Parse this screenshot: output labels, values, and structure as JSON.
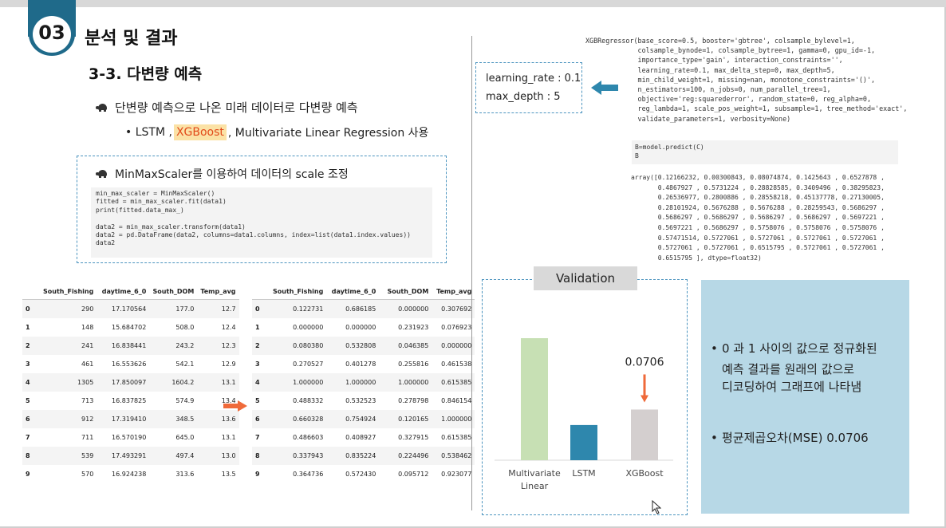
{
  "slide": {
    "section_number": "03",
    "section_title": "분석 및 결과",
    "subtitle": "3-3. 다변량 예측"
  },
  "bullets": {
    "main": "단변량 예측으로 나온 미래 데이터로 다변량 예측",
    "sub_prefix": "• LSTM ,",
    "sub_highlight": "XGBoost",
    "sub_suffix": ", Multivariate Linear Regression 사용"
  },
  "scaler_box": {
    "heading": "MinMaxScaler를 이용하여 데이터의 scale 조정",
    "code": "min_max_scaler = MinMaxScaler()\nfitted = min_max_scaler.fit(data1)\nprint(fitted.data_max_)\n\ndata2 = min_max_scaler.transform(data1)\ndata2 = pd.DataFrame(data2, columns=data1.columns, index=list(data1.index.values))\ndata2"
  },
  "table_raw": {
    "columns": [
      "",
      "South_Fishing",
      "daytime_6_0",
      "South_DOM",
      "Temp_avg"
    ],
    "rows": [
      [
        "0",
        "290",
        "17.170564",
        "177.0",
        "12.7"
      ],
      [
        "1",
        "148",
        "15.684702",
        "508.0",
        "12.4"
      ],
      [
        "2",
        "241",
        "16.838441",
        "243.2",
        "12.3"
      ],
      [
        "3",
        "461",
        "16.553626",
        "542.1",
        "12.9"
      ],
      [
        "4",
        "1305",
        "17.850097",
        "1604.2",
        "13.1"
      ],
      [
        "5",
        "713",
        "16.837825",
        "574.9",
        "13.4"
      ],
      [
        "6",
        "912",
        "17.319410",
        "348.5",
        "13.6"
      ],
      [
        "7",
        "711",
        "16.570190",
        "645.0",
        "13.1"
      ],
      [
        "8",
        "539",
        "17.493291",
        "497.4",
        "13.0"
      ],
      [
        "9",
        "570",
        "16.924238",
        "313.6",
        "13.5"
      ]
    ]
  },
  "table_scaled": {
    "columns": [
      "",
      "South_Fishing",
      "daytime_6_0",
      "South_DOM",
      "Temp_avg"
    ],
    "rows": [
      [
        "0",
        "0.122731",
        "0.686185",
        "0.000000",
        "0.307692"
      ],
      [
        "1",
        "0.000000",
        "0.000000",
        "0.231923",
        "0.076923"
      ],
      [
        "2",
        "0.080380",
        "0.532808",
        "0.046385",
        "0.000000"
      ],
      [
        "3",
        "0.270527",
        "0.401278",
        "0.255816",
        "0.461538"
      ],
      [
        "4",
        "1.000000",
        "1.000000",
        "1.000000",
        "0.615385"
      ],
      [
        "5",
        "0.488332",
        "0.532523",
        "0.278798",
        "0.846154"
      ],
      [
        "6",
        "0.660328",
        "0.754924",
        "0.120165",
        "1.000000"
      ],
      [
        "7",
        "0.486603",
        "0.408927",
        "0.327915",
        "0.615385"
      ],
      [
        "8",
        "0.337943",
        "0.835224",
        "0.224496",
        "0.538462"
      ],
      [
        "9",
        "0.364736",
        "0.572430",
        "0.095712",
        "0.923077"
      ]
    ]
  },
  "params": {
    "learning_rate": "learning_rate : 0.1",
    "max_depth": "max_depth : 5"
  },
  "xgb_repr": "XGBRegressor(base_score=0.5, booster='gbtree', colsample_bylevel=1,\n             colsample_bynode=1, colsample_bytree=1, gamma=0, gpu_id=-1,\n             importance_type='gain', interaction_constraints='',\n             learning_rate=0.1, max_delta_step=0, max_depth=5,\n             min_child_weight=1, missing=nan, monotone_constraints='()',\n             n_estimators=100, n_jobs=0, num_parallel_tree=1,\n             objective='reg:squarederror', random_state=0, reg_alpha=0,\n             reg_lambda=1, scale_pos_weight=1, subsample=1, tree_method='exact',\n             validate_parameters=1, verbosity=None)",
  "predict_code": "B=model.predict(C)\nB",
  "array_output": "array([0.12166232, 0.00300843, 0.08074874, 0.1425643 , 0.6527878 ,\n       0.4867927 , 0.5731224 , 0.28828585, 0.3409496 , 0.38295823,\n       0.26536977, 0.2800886 , 0.28558218, 0.45137778, 0.27130005,\n       0.28101924, 0.5676288 , 0.5676288 , 0.28259543, 0.5686297 ,\n       0.5686297 , 0.5686297 , 0.5686297 , 0.5686297 , 0.5697221 ,\n       0.5697221 , 0.5686297 , 0.5758076 , 0.5758076 , 0.5758076 ,\n       0.57471514, 0.5727061 , 0.5727061 , 0.5727061 , 0.5727061 ,\n       0.5727061 , 0.5727061 , 0.6515795 , 0.5727061 , 0.5727061 ,\n       0.6515795 ], dtype=float32)",
  "validation": {
    "title": "Validation",
    "annotation": "0.0706"
  },
  "chart_data": {
    "type": "bar",
    "categories": [
      "Multivariate Linear",
      "LSTM",
      "XGBoost"
    ],
    "category_lines": [
      [
        "Multivariate",
        "Linear"
      ],
      [
        "LSTM"
      ],
      [
        "XGBoost"
      ]
    ],
    "values": [
      0.17,
      0.049,
      0.0706
    ],
    "colors": [
      "#c7e0b4",
      "#2e87ad",
      "#d4cfcf"
    ],
    "annotated_value": "0.0706",
    "title": "Validation",
    "ylim": [
      0,
      0.2
    ],
    "grid": false,
    "axes_visible": false
  },
  "notes": {
    "line1": "0 과 1 사이의 값으로 정규화된",
    "line2": "예측 결과를 원래의 값으로",
    "line3": "디코딩하여 그래프에 나타냄",
    "line4": "평균제곱오차(MSE) 0.0706",
    "bullet": "•"
  },
  "colors": {
    "accent_blue": "#1f6a8a",
    "highlight_bg": "#fbe2a6",
    "highlight_text": "#e24a1a",
    "arrow_orange": "#ef6a3a",
    "arrow_blue": "#2e87ad",
    "note_bg": "#b7d8e6"
  }
}
